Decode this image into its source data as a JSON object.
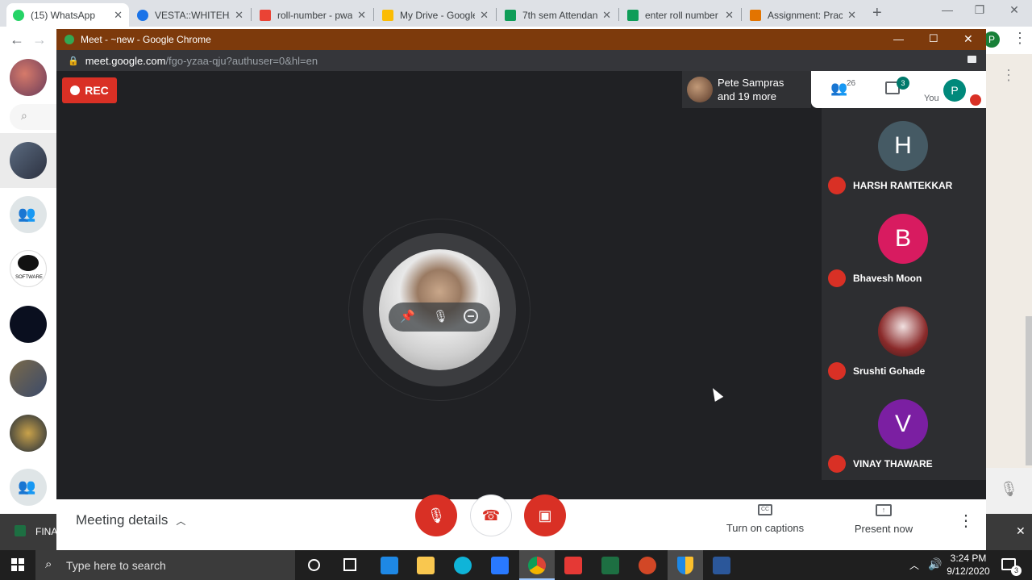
{
  "main_tabs": [
    {
      "title": "(15) WhatsApp",
      "color": "#25d366",
      "active": true
    },
    {
      "title": "VESTA::WHITEHAT",
      "color": "#1a73e8",
      "active": false
    },
    {
      "title": "roll-number - pwa",
      "color": "#ea4335",
      "active": false
    },
    {
      "title": "My Drive - Google",
      "color": "#fbbc04",
      "active": false
    },
    {
      "title": "7th sem Attendan",
      "color": "#0f9d58",
      "active": false
    },
    {
      "title": "enter roll number",
      "color": "#0f9d58",
      "active": false
    },
    {
      "title": "Assignment: Practi",
      "color": "#e37400",
      "active": false
    }
  ],
  "whatsapp": {
    "sidebar_labels": {
      "software_icon_text": "SOFTWARE"
    },
    "bottom_file": "FINA",
    "bottom_close": "✕"
  },
  "popup": {
    "title": "Meet - ~new - Google Chrome",
    "url_domain": "meet.google.com",
    "url_path": "/fgo-yzaa-qju?authuser=0&hl=en"
  },
  "meet": {
    "rec_label": "REC",
    "presenter_line1": "Pete Sampras",
    "presenter_line2": "and 19 more",
    "people_count": "26",
    "chat_count": "3",
    "you_label": "You",
    "you_initial": "P",
    "participants": [
      {
        "initial": "H",
        "name": "HARSH RAMTEKKAR",
        "color": "#455a64"
      },
      {
        "initial": "B",
        "name": "Bhavesh Moon",
        "color": "#d81b60"
      },
      {
        "initial": "",
        "name": "Srushti Gohade",
        "color": "#bdbdbd"
      },
      {
        "initial": "V",
        "name": "VINAY THAWARE",
        "color": "#7b1fa2"
      }
    ],
    "bottom": {
      "meeting_details": "Meeting details",
      "captions": "Turn on captions",
      "present": "Present now"
    }
  },
  "taskbar": {
    "search_placeholder": "Type here to search",
    "time": "3:24 PM",
    "date": "9/12/2020",
    "notification_count": "3"
  }
}
